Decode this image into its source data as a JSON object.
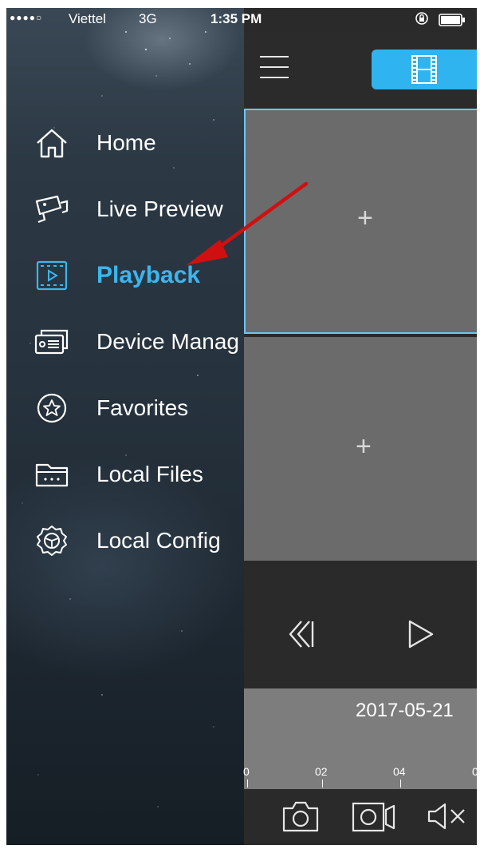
{
  "status_bar": {
    "signal": "●●●●○",
    "carrier": "Viettel",
    "network": "3G",
    "time": "1:35 PM"
  },
  "menu": {
    "items": [
      {
        "label": "Home",
        "icon": "home-icon"
      },
      {
        "label": "Live Preview",
        "icon": "camera-icon"
      },
      {
        "label": "Playback",
        "icon": "playback-icon",
        "active": true
      },
      {
        "label": "Device Manag",
        "icon": "device-icon"
      },
      {
        "label": "Favorites",
        "icon": "star-icon"
      },
      {
        "label": "Local Files",
        "icon": "folder-icon"
      },
      {
        "label": "Local Config",
        "icon": "gear-icon"
      }
    ]
  },
  "playback": {
    "pane_add": "+",
    "date": "2017-05-21",
    "ticks": [
      "0",
      "02",
      "04",
      "0"
    ]
  },
  "colors": {
    "accent": "#3db5ee",
    "pane": "#6b6b6b",
    "timeline": "#7d7d7d",
    "arrow": "#d01010"
  }
}
